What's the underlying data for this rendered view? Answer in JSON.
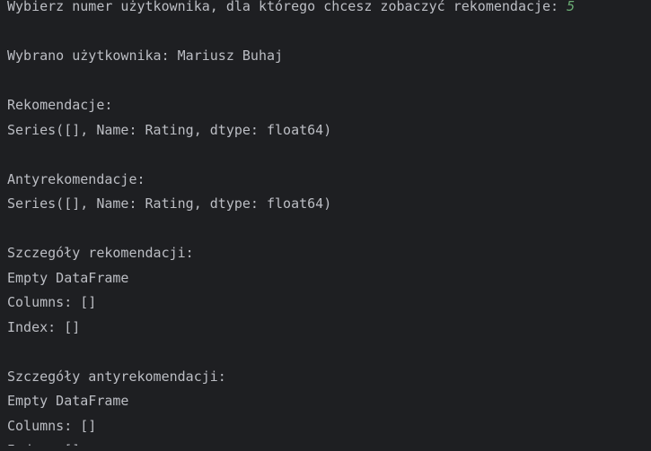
{
  "console": {
    "prompt_text": "Wybierz numer użytkownika, dla którego chcesz zobaczyć rekomendacje: ",
    "prompt_input": "5",
    "selected_user": "Wybrano użytkownika: Mariusz Buhaj",
    "recommendations_header": "Rekomendacje:",
    "recommendations_value": "Series([], Name: Rating, dtype: float64)",
    "antirecommendations_header": "Antyrekomendacje:",
    "antirecommendations_value": "Series([], Name: Rating, dtype: float64)",
    "rec_details_header": "Szczegóły rekomendacji:",
    "rec_details_empty": "Empty DataFrame",
    "rec_details_columns": "Columns: []",
    "rec_details_index": "Index: []",
    "antirec_details_header": "Szczegóły antyrekomendacji:",
    "antirec_details_empty": "Empty DataFrame",
    "antirec_details_columns": "Columns: []",
    "antirec_details_index": "Index: []"
  }
}
